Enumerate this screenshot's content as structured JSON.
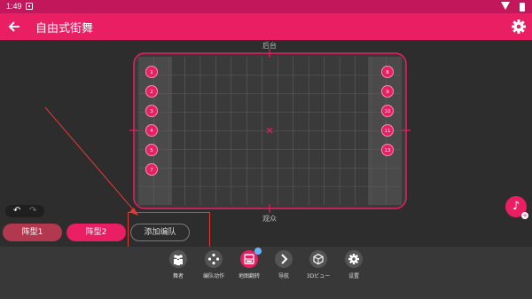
{
  "status": {
    "time": "1:49"
  },
  "appbar": {
    "title": "自由式街舞"
  },
  "stage": {
    "top_label": "后台",
    "bottom_label": "观众",
    "left_dancers": [
      "1",
      "2",
      "3",
      "4",
      "5",
      "7"
    ],
    "right_dancers": [
      "8",
      "9",
      "10",
      "11",
      "13"
    ]
  },
  "formations": {
    "f1": "阵型1",
    "f2": "阵型2",
    "add": "添加编队"
  },
  "toolbar": {
    "items": [
      {
        "label": "舞者",
        "icon": "dancers-icon"
      },
      {
        "label": "编队动作",
        "icon": "gamepad-icon"
      },
      {
        "label": "地图翻转",
        "icon": "flip-icon"
      },
      {
        "label": "导航",
        "icon": "chevron-right-icon"
      },
      {
        "label": "3Dビュー",
        "icon": "cube-icon"
      },
      {
        "label": "设置",
        "icon": "gear-icon"
      }
    ]
  },
  "colors": {
    "primary": "#e91e63",
    "status": "#c2185b",
    "background": "#2d2d2d",
    "annotation": "#e53935"
  }
}
